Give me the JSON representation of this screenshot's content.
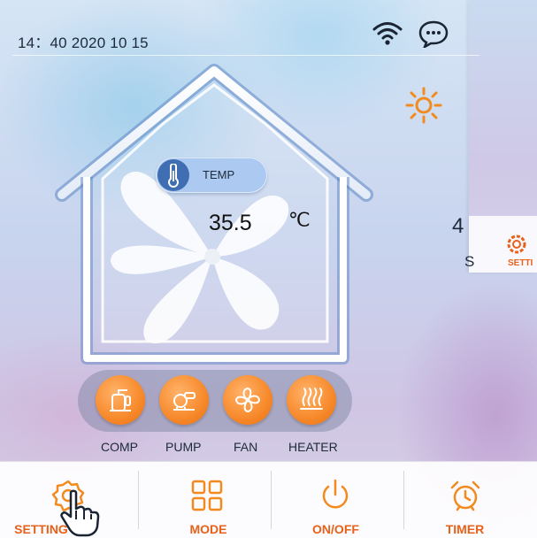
{
  "status": {
    "time": "14：40 2020 10 15",
    "icons": [
      "wifi-icon",
      "chat-icon",
      "sun-icon"
    ]
  },
  "temperature": {
    "label": "TEMP",
    "value": "35.5",
    "unit": "℃",
    "icon": "thermometer-icon"
  },
  "components": [
    {
      "label": "COMP",
      "icon": "compressor-icon"
    },
    {
      "label": "PUMP",
      "icon": "pump-icon"
    },
    {
      "label": "FAN",
      "icon": "fan-icon"
    },
    {
      "label": "HEATER",
      "icon": "heater-icon"
    }
  ],
  "bottom_nav": [
    {
      "label": "SETTING",
      "icon": "gear-icon"
    },
    {
      "label": "MODE",
      "icon": "grid-icon"
    },
    {
      "label": "ON/OFF",
      "icon": "power-icon"
    },
    {
      "label": "TIMER",
      "icon": "alarm-clock-icon"
    }
  ],
  "side_screen": {
    "digit": "4",
    "letter": "S",
    "setting_label": "SETTI"
  },
  "colors": {
    "accent": "#e8611a",
    "component_orange": "#f7892a",
    "temp_pill": "#aac8f0",
    "house_outline": "#ffffff"
  }
}
